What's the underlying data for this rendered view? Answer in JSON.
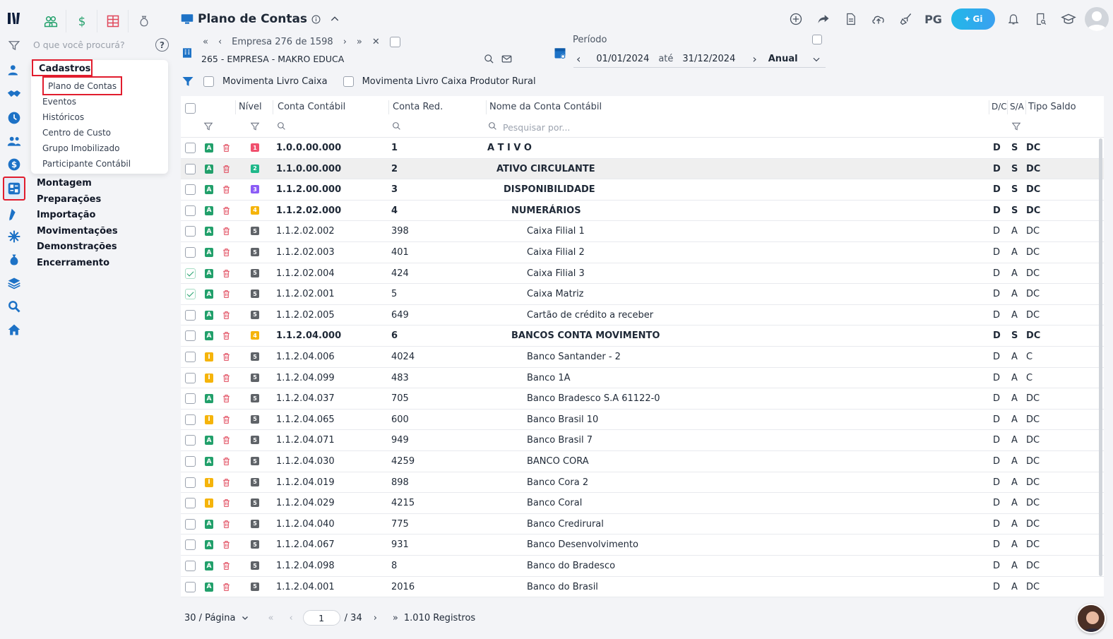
{
  "app": {
    "title": "Plano de Contas",
    "search_placeholder": "O que você procurá?",
    "pg_label": "PG",
    "gi_label": "Gi"
  },
  "colors": {
    "accent": "#1d72c6",
    "highlight_border": "#e11d2e",
    "status_green": "#22a06b",
    "status_yellow": "#f5b40b",
    "level1": "#f0506e",
    "level2": "#1fb88a",
    "level3": "#8b5cf6",
    "level4": "#f5b40b",
    "level5": "#5f6368"
  },
  "menu": {
    "section": "Cadastros",
    "sub_items": [
      "Plano de Contas",
      "Eventos",
      "Históricos",
      "Centro de Custo",
      "Grupo Imobilizado",
      "Participante Contábil"
    ],
    "main_items": [
      "Montagem",
      "Preparações",
      "Importação",
      "Movimentações",
      "Demonstrações",
      "Encerramento"
    ]
  },
  "empresa": {
    "nav_label": "Empresa",
    "current": "276",
    "of_label": "de",
    "total": "1598",
    "name": "265 - EMPRESA - MAKRO EDUCA"
  },
  "periodo": {
    "label": "Período",
    "start": "01/01/2024",
    "until_label": "até",
    "end": "31/12/2024",
    "type": "Anual"
  },
  "filters": {
    "livro_caixa": "Movimenta Livro Caixa",
    "livro_caixa_rural": "Movimenta Livro Caixa Produtor Rural"
  },
  "table": {
    "headers": {
      "nivel": "Nível",
      "conta_contabil": "Conta Contábil",
      "conta_red": "Conta Red.",
      "nome": "Nome da Conta Contábil",
      "dc": "D/C",
      "sa": "S/A",
      "tipo_saldo": "Tipo Saldo"
    },
    "search_placeholder": "Pesquisar por...",
    "rows": [
      {
        "checked": false,
        "status": "A",
        "level": "1",
        "conta": "1.0.0.00.000",
        "red": "1",
        "nome": "A T I V O",
        "dc": "D",
        "sa": "S",
        "tipo": "DC",
        "bold": true,
        "indent": 0
      },
      {
        "checked": false,
        "status": "A",
        "level": "2",
        "conta": "1.1.0.00.000",
        "red": "2",
        "nome": "ATIVO CIRCULANTE",
        "dc": "D",
        "sa": "S",
        "tipo": "DC",
        "bold": true,
        "indent": 1,
        "selected": true
      },
      {
        "checked": false,
        "status": "A",
        "level": "3",
        "conta": "1.1.2.00.000",
        "red": "3",
        "nome": "DISPONIBILIDADE",
        "dc": "D",
        "sa": "S",
        "tipo": "DC",
        "bold": true,
        "indent": 2
      },
      {
        "checked": false,
        "status": "A",
        "level": "4",
        "conta": "1.1.2.02.000",
        "red": "4",
        "nome": "NUMERÁRIOS",
        "dc": "D",
        "sa": "S",
        "tipo": "DC",
        "bold": true,
        "indent": 3
      },
      {
        "checked": false,
        "status": "A",
        "level": "5",
        "conta": "1.1.2.02.002",
        "red": "398",
        "nome": "Caixa Filial 1",
        "dc": "D",
        "sa": "A",
        "tipo": "DC",
        "bold": false,
        "indent": 4
      },
      {
        "checked": false,
        "status": "A",
        "level": "5",
        "conta": "1.1.2.02.003",
        "red": "401",
        "nome": "Caixa Filial 2",
        "dc": "D",
        "sa": "A",
        "tipo": "DC",
        "bold": false,
        "indent": 4
      },
      {
        "checked": true,
        "status": "A",
        "level": "5",
        "conta": "1.1.2.02.004",
        "red": "424",
        "nome": "Caixa Filial 3",
        "dc": "D",
        "sa": "A",
        "tipo": "DC",
        "bold": false,
        "indent": 4
      },
      {
        "checked": true,
        "status": "A",
        "level": "5",
        "conta": "1.1.2.02.001",
        "red": "5",
        "nome": "Caixa Matriz",
        "dc": "D",
        "sa": "A",
        "tipo": "DC",
        "bold": false,
        "indent": 4
      },
      {
        "checked": false,
        "status": "A",
        "level": "5",
        "conta": "1.1.2.02.005",
        "red": "649",
        "nome": "Cartão de crédito a receber",
        "dc": "D",
        "sa": "A",
        "tipo": "DC",
        "bold": false,
        "indent": 4
      },
      {
        "checked": false,
        "status": "A",
        "level": "4",
        "conta": "1.1.2.04.000",
        "red": "6",
        "nome": "BANCOS CONTA MOVIMENTO",
        "dc": "D",
        "sa": "S",
        "tipo": "DC",
        "bold": true,
        "indent": 3
      },
      {
        "checked": false,
        "status": "I",
        "level": "5",
        "conta": "1.1.2.04.006",
        "red": "4024",
        "nome": "Banco Santander - 2",
        "dc": "D",
        "sa": "A",
        "tipo": "C",
        "bold": false,
        "indent": 4
      },
      {
        "checked": false,
        "status": "I",
        "level": "5",
        "conta": "1.1.2.04.099",
        "red": "483",
        "nome": "Banco 1A",
        "dc": "D",
        "sa": "A",
        "tipo": "C",
        "bold": false,
        "indent": 4
      },
      {
        "checked": false,
        "status": "A",
        "level": "5",
        "conta": "1.1.2.04.037",
        "red": "705",
        "nome": "Banco Bradesco S.A 61122-0",
        "dc": "D",
        "sa": "A",
        "tipo": "DC",
        "bold": false,
        "indent": 4
      },
      {
        "checked": false,
        "status": "I",
        "level": "5",
        "conta": "1.1.2.04.065",
        "red": "600",
        "nome": "Banco Brasil 10",
        "dc": "D",
        "sa": "A",
        "tipo": "DC",
        "bold": false,
        "indent": 4
      },
      {
        "checked": false,
        "status": "A",
        "level": "5",
        "conta": "1.1.2.04.071",
        "red": "949",
        "nome": "Banco Brasil 7",
        "dc": "D",
        "sa": "A",
        "tipo": "DC",
        "bold": false,
        "indent": 4
      },
      {
        "checked": false,
        "status": "A",
        "level": "5",
        "conta": "1.1.2.04.030",
        "red": "4259",
        "nome": "BANCO CORA",
        "dc": "D",
        "sa": "A",
        "tipo": "DC",
        "bold": false,
        "indent": 4
      },
      {
        "checked": false,
        "status": "I",
        "level": "5",
        "conta": "1.1.2.04.019",
        "red": "898",
        "nome": "Banco Cora 2",
        "dc": "D",
        "sa": "A",
        "tipo": "DC",
        "bold": false,
        "indent": 4
      },
      {
        "checked": false,
        "status": "I",
        "level": "5",
        "conta": "1.1.2.04.029",
        "red": "4215",
        "nome": "Banco Coral",
        "dc": "D",
        "sa": "A",
        "tipo": "DC",
        "bold": false,
        "indent": 4
      },
      {
        "checked": false,
        "status": "A",
        "level": "5",
        "conta": "1.1.2.04.040",
        "red": "775",
        "nome": "Banco Credirural",
        "dc": "D",
        "sa": "A",
        "tipo": "DC",
        "bold": false,
        "indent": 4
      },
      {
        "checked": false,
        "status": "A",
        "level": "5",
        "conta": "1.1.2.04.067",
        "red": "931",
        "nome": "Banco Desenvolvimento",
        "dc": "D",
        "sa": "A",
        "tipo": "DC",
        "bold": false,
        "indent": 4
      },
      {
        "checked": false,
        "status": "A",
        "level": "5",
        "conta": "1.1.2.04.098",
        "red": "8",
        "nome": "Banco do Bradesco",
        "dc": "D",
        "sa": "A",
        "tipo": "DC",
        "bold": false,
        "indent": 4
      },
      {
        "checked": false,
        "status": "A",
        "level": "5",
        "conta": "1.1.2.04.001",
        "red": "2016",
        "nome": "Banco do Brasil",
        "dc": "D",
        "sa": "A",
        "tipo": "DC",
        "bold": false,
        "indent": 4
      }
    ]
  },
  "pagination": {
    "per_page": "30 / Página",
    "current": "1",
    "total_pages": "/ 34",
    "records": "1.010 Registros"
  }
}
